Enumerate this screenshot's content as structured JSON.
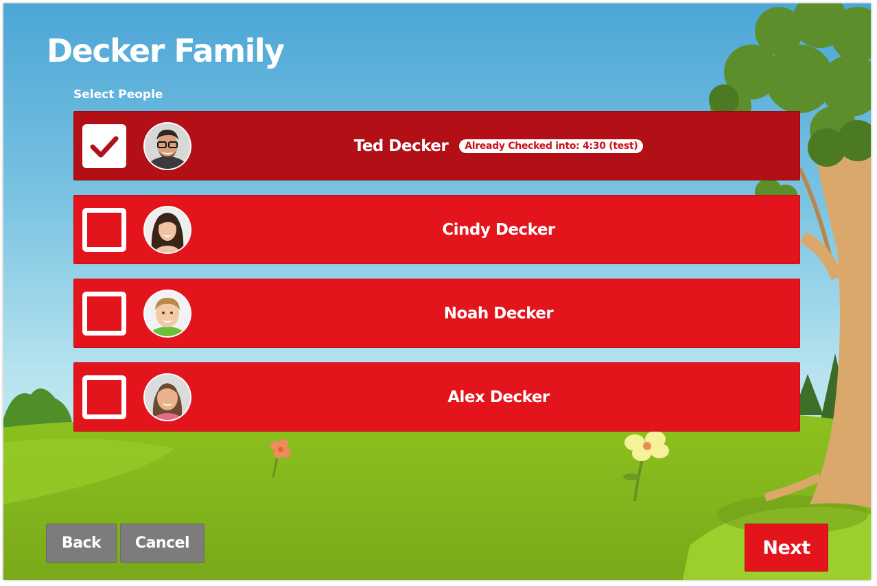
{
  "header": {
    "title": "Decker Family",
    "subtitle": "Select People"
  },
  "people": [
    {
      "name": "Ted Decker",
      "selected": true,
      "badge": "Already Checked into: 4:30 (test)"
    },
    {
      "name": "Cindy Decker",
      "selected": false
    },
    {
      "name": "Noah Decker",
      "selected": false
    },
    {
      "name": "Alex Decker",
      "selected": false
    }
  ],
  "footer": {
    "back_label": "Back",
    "cancel_label": "Cancel",
    "next_label": "Next"
  },
  "colors": {
    "primary_red": "#e3141c",
    "selected_red": "#b21016",
    "button_grey": "#7c7c7c"
  },
  "icons": {
    "checkbox_checked": "checkmark-icon"
  }
}
